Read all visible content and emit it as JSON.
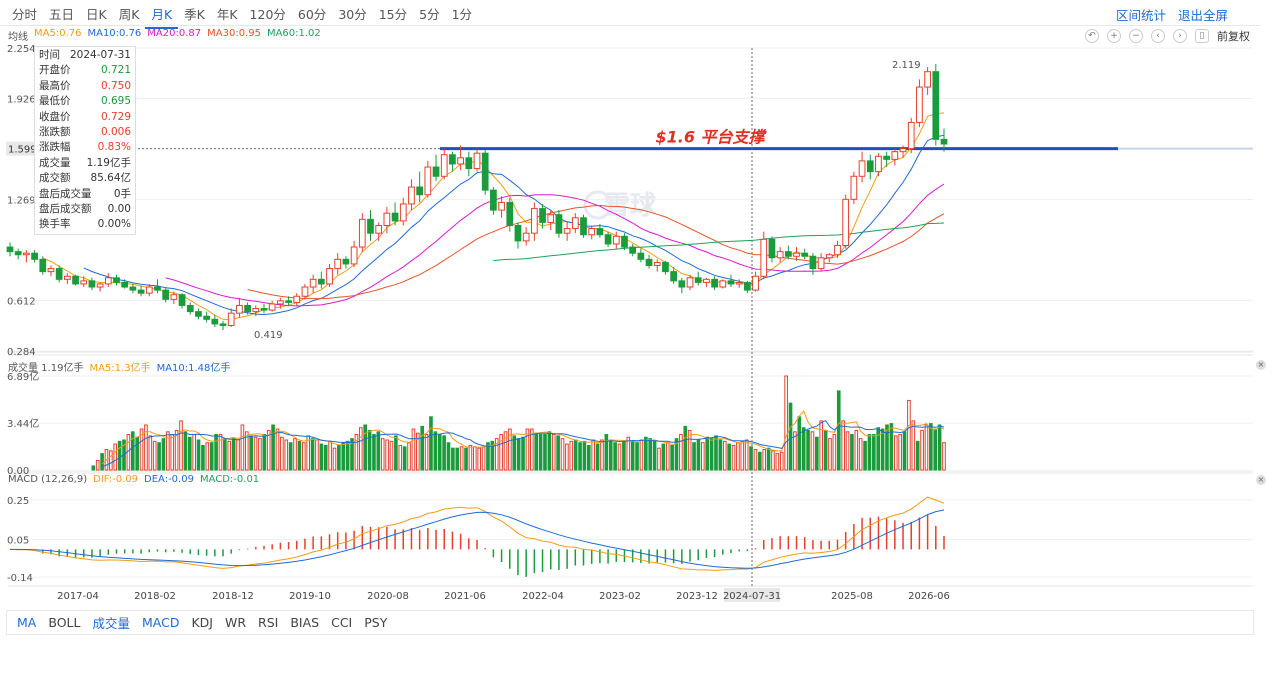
{
  "period_tabs": [
    "分时",
    "五日",
    "日K",
    "周K",
    "月K",
    "季K",
    "年K",
    "120分",
    "60分",
    "30分",
    "15分",
    "5分",
    "1分"
  ],
  "active_period": "月K",
  "top_actions": {
    "range_stats": "区间统计",
    "exit_fullscreen": "退出全屏"
  },
  "adjust_label": "前复权",
  "ma_legend": {
    "title": "均线",
    "items": [
      {
        "label": "MA5:0.76",
        "color": "#f39c12"
      },
      {
        "label": "MA10:0.76",
        "color": "#1e6bd6"
      },
      {
        "label": "MA20:0.87",
        "color": "#d81bd0"
      },
      {
        "label": "MA30:0.95",
        "color": "#e8542a"
      },
      {
        "label": "MA60:1.02",
        "color": "#1aa35c"
      }
    ]
  },
  "info_box": {
    "rows": [
      {
        "label": "时间",
        "value": "2024-07-31",
        "tone": "neutral"
      },
      {
        "label": "开盘价",
        "value": "0.721",
        "tone": "green"
      },
      {
        "label": "最高价",
        "value": "0.750",
        "tone": "red"
      },
      {
        "label": "最低价",
        "value": "0.695",
        "tone": "green"
      },
      {
        "label": "收盘价",
        "value": "0.729",
        "tone": "red"
      },
      {
        "label": "涨跌额",
        "value": "0.006",
        "tone": "red"
      },
      {
        "label": "涨跌幅",
        "value": "0.83%",
        "tone": "red"
      },
      {
        "label": "成交量",
        "value": "1.19亿手",
        "tone": "neutral"
      },
      {
        "label": "成交额",
        "value": "85.64亿",
        "tone": "neutral"
      },
      {
        "label": "盘后成交量",
        "value": "0手",
        "tone": "neutral"
      },
      {
        "label": "盘后成交额",
        "value": "0.00",
        "tone": "neutral"
      },
      {
        "label": "换手率",
        "value": "0.00%",
        "tone": "neutral"
      }
    ]
  },
  "volume_legend": {
    "title": "成交量 1.19亿手",
    "ma5": "MA5:1.3亿手",
    "ma5_color": "#f39c12",
    "ma10": "MA10:1.48亿手",
    "ma10_color": "#1e6bd6"
  },
  "macd_legend": {
    "title": "MACD (12,26,9)",
    "dif": "DIF:-0.09",
    "dif_color": "#f39c12",
    "dea": "DEA:-0.09",
    "dea_color": "#1e6bd6",
    "macd": "MACD:-0.01",
    "macd_color": "#1aa35c"
  },
  "indicator_tabs": [
    {
      "label": "MA",
      "active": true
    },
    {
      "label": "BOLL",
      "active": false
    },
    {
      "label": "成交量",
      "active": true
    },
    {
      "label": "MACD",
      "active": true
    },
    {
      "label": "KDJ",
      "active": false
    },
    {
      "label": "WR",
      "active": false
    },
    {
      "label": "RSI",
      "active": false
    },
    {
      "label": "BIAS",
      "active": false
    },
    {
      "label": "CCI",
      "active": false
    },
    {
      "label": "PSY",
      "active": false
    }
  ],
  "chart_data": {
    "type": "candlestick",
    "price_axis_ticks": [
      "2.254",
      "1.926",
      "1.599",
      "1.269",
      "0.612",
      "0.284"
    ],
    "price_axis_values": [
      2.254,
      1.926,
      1.599,
      1.269,
      0.612,
      0.284
    ],
    "price_range": [
      0.284,
      2.254
    ],
    "volume_axis_ticks": [
      "6.89亿",
      "3.44亿",
      "0.00"
    ],
    "volume_range": [
      0,
      6.89
    ],
    "macd_axis_ticks": [
      "0.25",
      "0.05",
      "-0.14"
    ],
    "macd_range": [
      -0.18,
      0.3
    ],
    "x_ticks": [
      "2017-04",
      "2018-02",
      "2018-12",
      "2019-10",
      "2020-08",
      "2021-06",
      "2022-04",
      "2023-02",
      "2023-12",
      "2024-07-31",
      "2025-08",
      "2026-06"
    ],
    "crosshair_label": "2024-07-31",
    "crosshair_price": "1.599",
    "annotation": {
      "text": "$1.6 平台支撑",
      "price": 1.6,
      "color": "#e03020",
      "line_color": "#1f4fc0"
    },
    "max_label": "2.119",
    "min_label": "0.419",
    "watermark": "雪球",
    "up_color": "#e5402d",
    "down_color": "#1a9b3c",
    "candles": [
      [
        0.96,
        0.99,
        0.9,
        0.93
      ],
      [
        0.93,
        0.95,
        0.88,
        0.91
      ],
      [
        0.91,
        0.94,
        0.86,
        0.92
      ],
      [
        0.92,
        0.94,
        0.86,
        0.88
      ],
      [
        0.88,
        0.9,
        0.78,
        0.8
      ],
      [
        0.8,
        0.84,
        0.77,
        0.82
      ],
      [
        0.82,
        0.84,
        0.73,
        0.75
      ],
      [
        0.75,
        0.79,
        0.72,
        0.77
      ],
      [
        0.77,
        0.78,
        0.71,
        0.72
      ],
      [
        0.72,
        0.77,
        0.7,
        0.74
      ],
      [
        0.74,
        0.76,
        0.68,
        0.7
      ],
      [
        0.7,
        0.73,
        0.67,
        0.72
      ],
      [
        0.72,
        0.79,
        0.7,
        0.76
      ],
      [
        0.76,
        0.78,
        0.71,
        0.73
      ],
      [
        0.73,
        0.75,
        0.69,
        0.7
      ],
      [
        0.7,
        0.72,
        0.66,
        0.68
      ],
      [
        0.68,
        0.71,
        0.64,
        0.66
      ],
      [
        0.66,
        0.72,
        0.64,
        0.7
      ],
      [
        0.7,
        0.75,
        0.66,
        0.68
      ],
      [
        0.68,
        0.7,
        0.6,
        0.62
      ],
      [
        0.62,
        0.67,
        0.59,
        0.65
      ],
      [
        0.65,
        0.66,
        0.56,
        0.58
      ],
      [
        0.58,
        0.6,
        0.52,
        0.54
      ],
      [
        0.54,
        0.56,
        0.49,
        0.51
      ],
      [
        0.51,
        0.54,
        0.47,
        0.49
      ],
      [
        0.49,
        0.52,
        0.44,
        0.46
      ],
      [
        0.46,
        0.48,
        0.42,
        0.45
      ],
      [
        0.45,
        0.56,
        0.44,
        0.53
      ],
      [
        0.53,
        0.63,
        0.5,
        0.58
      ],
      [
        0.58,
        0.6,
        0.52,
        0.54
      ],
      [
        0.54,
        0.58,
        0.51,
        0.56
      ],
      [
        0.56,
        0.59,
        0.53,
        0.55
      ],
      [
        0.55,
        0.61,
        0.54,
        0.59
      ],
      [
        0.59,
        0.63,
        0.56,
        0.61
      ],
      [
        0.61,
        0.64,
        0.58,
        0.6
      ],
      [
        0.6,
        0.66,
        0.58,
        0.64
      ],
      [
        0.64,
        0.72,
        0.62,
        0.7
      ],
      [
        0.7,
        0.78,
        0.66,
        0.75
      ],
      [
        0.75,
        0.8,
        0.69,
        0.72
      ],
      [
        0.72,
        0.85,
        0.7,
        0.82
      ],
      [
        0.82,
        0.92,
        0.78,
        0.88
      ],
      [
        0.88,
        0.9,
        0.82,
        0.85
      ],
      [
        0.85,
        1.0,
        0.83,
        0.96
      ],
      [
        0.96,
        1.18,
        0.93,
        1.14
      ],
      [
        1.14,
        1.2,
        1.0,
        1.05
      ],
      [
        1.05,
        1.12,
        1.0,
        1.1
      ],
      [
        1.1,
        1.22,
        1.05,
        1.18
      ],
      [
        1.18,
        1.25,
        1.1,
        1.13
      ],
      [
        1.13,
        1.28,
        1.1,
        1.24
      ],
      [
        1.24,
        1.4,
        1.2,
        1.35
      ],
      [
        1.35,
        1.45,
        1.25,
        1.3
      ],
      [
        1.3,
        1.52,
        1.28,
        1.48
      ],
      [
        1.48,
        1.56,
        1.39,
        1.42
      ],
      [
        1.42,
        1.6,
        1.4,
        1.56
      ],
      [
        1.56,
        1.58,
        1.45,
        1.5
      ],
      [
        1.5,
        1.62,
        1.46,
        1.54
      ],
      [
        1.54,
        1.58,
        1.42,
        1.47
      ],
      [
        1.47,
        1.6,
        1.45,
        1.57
      ],
      [
        1.57,
        1.59,
        1.3,
        1.33
      ],
      [
        1.33,
        1.35,
        1.17,
        1.2
      ],
      [
        1.2,
        1.29,
        1.15,
        1.25
      ],
      [
        1.25,
        1.28,
        1.06,
        1.1
      ],
      [
        1.1,
        1.12,
        0.95,
        1.0
      ],
      [
        1.0,
        1.09,
        0.97,
        1.05
      ],
      [
        1.05,
        1.25,
        1.0,
        1.21
      ],
      [
        1.21,
        1.24,
        1.08,
        1.12
      ],
      [
        1.12,
        1.2,
        1.07,
        1.17
      ],
      [
        1.17,
        1.2,
        1.02,
        1.05
      ],
      [
        1.05,
        1.12,
        1.0,
        1.08
      ],
      [
        1.08,
        1.18,
        1.05,
        1.15
      ],
      [
        1.15,
        1.17,
        1.02,
        1.04
      ],
      [
        1.04,
        1.1,
        1.01,
        1.08
      ],
      [
        1.08,
        1.11,
        1.02,
        1.04
      ],
      [
        1.04,
        1.06,
        0.96,
        0.98
      ],
      [
        0.98,
        1.06,
        0.95,
        1.03
      ],
      [
        1.03,
        1.05,
        0.94,
        0.96
      ],
      [
        0.96,
        0.98,
        0.9,
        0.92
      ],
      [
        0.92,
        0.95,
        0.86,
        0.88
      ],
      [
        0.88,
        0.91,
        0.82,
        0.84
      ],
      [
        0.84,
        0.88,
        0.8,
        0.86
      ],
      [
        0.86,
        0.87,
        0.78,
        0.8
      ],
      [
        0.8,
        0.83,
        0.72,
        0.74
      ],
      [
        0.74,
        0.76,
        0.66,
        0.7
      ],
      [
        0.7,
        0.78,
        0.68,
        0.76
      ],
      [
        0.76,
        0.8,
        0.71,
        0.73
      ],
      [
        0.73,
        0.76,
        0.7,
        0.75
      ],
      [
        0.75,
        0.77,
        0.68,
        0.7
      ],
      [
        0.7,
        0.75,
        0.69,
        0.74
      ],
      [
        0.74,
        0.78,
        0.7,
        0.72
      ],
      [
        0.72,
        0.75,
        0.695,
        0.729
      ],
      [
        0.729,
        0.74,
        0.66,
        0.68
      ],
      [
        0.68,
        0.8,
        0.67,
        0.77
      ],
      [
        0.77,
        1.06,
        0.75,
        1.01
      ],
      [
        1.01,
        1.03,
        0.86,
        0.89
      ],
      [
        0.89,
        0.96,
        0.86,
        0.93
      ],
      [
        0.93,
        0.97,
        0.88,
        0.9
      ],
      [
        0.9,
        0.96,
        0.87,
        0.92
      ],
      [
        0.92,
        0.95,
        0.88,
        0.9
      ],
      [
        0.9,
        0.92,
        0.78,
        0.82
      ],
      [
        0.82,
        0.92,
        0.8,
        0.89
      ],
      [
        0.89,
        0.92,
        0.86,
        0.91
      ],
      [
        0.91,
        1.0,
        0.89,
        0.97
      ],
      [
        0.97,
        1.3,
        0.95,
        1.27
      ],
      [
        1.27,
        1.45,
        1.24,
        1.42
      ],
      [
        1.42,
        1.58,
        1.38,
        1.52
      ],
      [
        1.52,
        1.56,
        1.4,
        1.45
      ],
      [
        1.45,
        1.57,
        1.42,
        1.55
      ],
      [
        1.55,
        1.58,
        1.48,
        1.53
      ],
      [
        1.53,
        1.6,
        1.49,
        1.58
      ],
      [
        1.58,
        1.62,
        1.54,
        1.6
      ],
      [
        1.6,
        1.8,
        1.57,
        1.77
      ],
      [
        1.77,
        2.05,
        1.74,
        2.0
      ],
      [
        2.0,
        2.13,
        1.95,
        2.1
      ],
      [
        2.1,
        2.15,
        1.62,
        1.66
      ],
      [
        1.66,
        1.73,
        1.58,
        1.63
      ]
    ],
    "volumes": [
      0,
      0,
      0,
      0,
      0,
      0,
      0,
      0,
      0,
      0,
      0,
      0,
      0,
      0,
      0,
      0,
      0,
      0,
      0,
      0.3,
      0.7,
      1.2,
      1.5,
      1.4,
      1.9,
      2.1,
      2.2,
      2.6,
      2.8,
      2.4,
      3.0,
      3.3,
      2.5,
      2.1,
      2.0,
      2.3,
      2.8,
      2.6,
      2.9,
      3.6,
      2.8,
      2.4,
      2.6,
      2.2,
      1.8,
      2.0,
      2.0,
      2.6,
      2.6,
      2.3,
      2.1,
      2.3,
      2.2,
      3.3,
      2.8,
      2.5,
      2.4,
      2.3,
      2.6,
      2.9,
      3.3,
      3.0,
      2.4,
      2.2,
      2.0,
      2.3,
      2.1,
      2.0,
      2.5,
      2.3,
      2.2,
      1.9,
      1.8,
      2.1,
      1.6,
      1.8,
      2.0,
      2.1,
      2.3,
      2.6,
      3.1,
      3.3,
      2.9,
      2.6,
      2.8,
      2.3,
      2.2,
      2.1,
      2.5,
      1.8,
      1.7,
      2.0,
      3.0,
      2.7,
      3.2,
      2.6,
      3.9,
      2.8,
      2.6,
      2.5,
      2.0,
      1.6,
      1.6,
      1.7,
      1.6,
      1.8,
      1.7,
      1.6,
      1.7,
      2.0,
      2.1,
      2.3,
      2.6,
      2.8,
      3.0,
      2.5,
      2.3,
      2.4,
      3.0,
      3.0,
      2.7,
      2.6,
      2.6,
      2.8,
      2.6,
      2.5,
      2.3,
      1.9,
      2.1,
      2.2,
      2.0,
      2.1,
      1.8,
      2.2,
      1.9,
      2.2,
      2.6,
      2.2,
      2.0,
      1.9,
      2.1,
      2.4,
      2.1,
      2.0,
      2.2,
      2.4,
      2.3,
      2.1,
      1.6,
      1.9,
      2.0,
      1.8,
      2.3,
      2.6,
      3.2,
      2.9,
      2.0,
      2.2,
      2.0,
      2.4,
      2.3,
      2.5,
      2.2,
      2.1,
      1.9,
      1.8,
      2.0,
      2.1,
      2.2,
      1.7,
      1.5,
      1.3,
      1.5,
      1.6,
      1.4,
      1.2,
      1.3,
      6.89,
      4.9,
      2.8,
      3.9,
      3.1,
      2.9,
      2.8,
      2.4,
      3.6,
      2.9,
      2.3,
      2.6,
      5.8,
      3.6,
      2.8,
      2.6,
      2.9,
      2.3,
      2.1,
      2.6,
      2.6,
      3.1,
      3.0,
      3.3,
      3.4,
      2.5,
      2.6,
      2.8,
      5.1,
      3.6,
      2.1,
      2.9,
      3.3,
      3.4,
      3.0,
      3.3,
      2.0
    ],
    "ma_series": [
      {
        "name": "MA5",
        "color": "#f39c12"
      },
      {
        "name": "MA10",
        "color": "#1e6bd6"
      },
      {
        "name": "MA20",
        "color": "#d81bd0"
      },
      {
        "name": "MA30",
        "color": "#e8542a"
      },
      {
        "name": "MA60",
        "color": "#1aa35c"
      }
    ]
  }
}
